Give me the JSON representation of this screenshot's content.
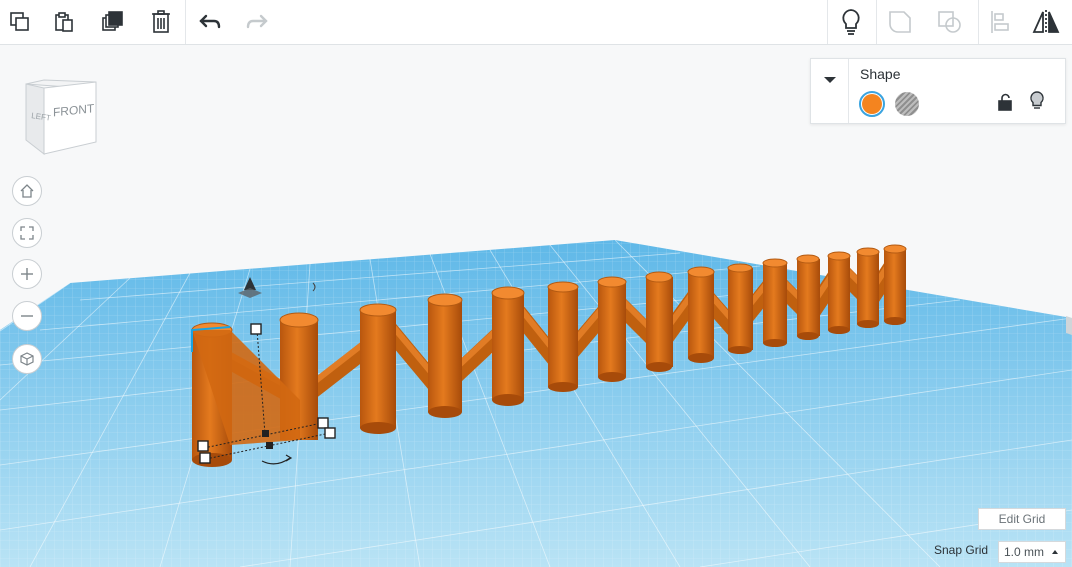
{
  "toolbar": {
    "left_tools": [
      {
        "name": "copy-icon"
      },
      {
        "name": "paste-icon"
      },
      {
        "name": "duplicate-icon"
      },
      {
        "name": "delete-icon"
      },
      {
        "name": "undo-icon"
      },
      {
        "name": "redo-icon"
      }
    ],
    "right_tools": [
      {
        "name": "lightbulb-icon"
      },
      {
        "name": "group-icon"
      },
      {
        "name": "ungroup-icon"
      },
      {
        "name": "align-icon"
      },
      {
        "name": "mirror-icon"
      }
    ]
  },
  "inspector": {
    "title": "Shape",
    "solid_color": "#f4841f",
    "hole_label_icon": "hole-swatch-icon"
  },
  "viewcube": {
    "left_face": "LEFT",
    "front_face": "FRONT"
  },
  "nav_controls": [
    {
      "name": "home-view-icon"
    },
    {
      "name": "fit-view-icon"
    },
    {
      "name": "zoom-in-icon"
    },
    {
      "name": "zoom-out-icon"
    },
    {
      "name": "perspective-icon"
    }
  ],
  "colors": {
    "grid_blue": "#8fd1ef",
    "shape_orange": "#d96c16",
    "accent_blue": "#3aa3df"
  },
  "footer": {
    "edit_grid_label": "Edit Grid",
    "snap_grid_label": "Snap Grid",
    "snap_grid_value": "1.0 mm"
  }
}
